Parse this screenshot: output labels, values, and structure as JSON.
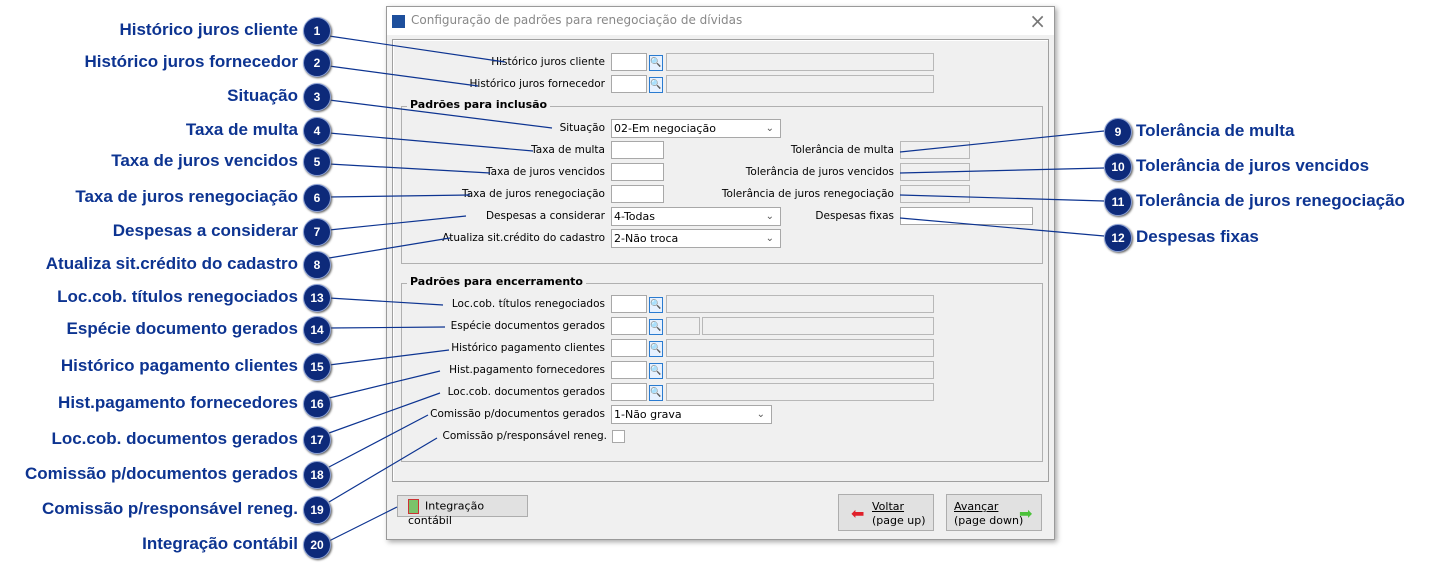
{
  "window": {
    "title": "Configuração de padrões para renegociação de dívidas",
    "close": "×"
  },
  "fields": {
    "historico_juros_cliente": "Histórico juros cliente",
    "historico_juros_fornecedor": "Histórico juros fornecedor",
    "group_inclusao": "Padrões para inclusão",
    "situacao": "Situação",
    "situacao_value": "02-Em negociação",
    "taxa_multa": "Taxa de multa",
    "taxa_juros_vencidos": "Taxa de juros vencidos",
    "taxa_juros_renegociacao": "Taxa de juros renegociação",
    "despesas_considerar": "Despesas a considerar",
    "despesas_considerar_value": "4-Todas",
    "atualiza_sit": "Atualiza sit.crédito do cadastro",
    "atualiza_sit_value": "2-Não troca",
    "tolerancia_multa": "Tolerância de multa",
    "tolerancia_juros_vencidos": "Tolerância de juros vencidos",
    "tolerancia_juros_renegociacao": "Tolerância de juros renegociação",
    "despesas_fixas": "Despesas fixas",
    "group_encerramento": "Padrões para encerramento",
    "loc_cob_titulos": "Loc.cob. títulos renegociados",
    "especie_documentos": "Espécie documentos gerados",
    "historico_pagamento_clientes": "Histórico pagamento clientes",
    "hist_pagamento_fornecedores": "Hist.pagamento fornecedores",
    "loc_cob_documentos": "Loc.cob. documentos gerados",
    "comissao_documentos": "Comissão p/documentos gerados",
    "comissao_documentos_value": "1-Não grava",
    "comissao_responsavel": "Comissão p/responsável reneg."
  },
  "buttons": {
    "integracao": "Integração contábil",
    "voltar": "Voltar",
    "voltar_sub": "(page up)",
    "avancar": "Avançar",
    "avancar_sub": "(page down)"
  },
  "callouts": [
    {
      "n": "1",
      "label": "Histórico juros cliente"
    },
    {
      "n": "2",
      "label": "Histórico juros fornecedor"
    },
    {
      "n": "3",
      "label": "Situação"
    },
    {
      "n": "4",
      "label": "Taxa de multa"
    },
    {
      "n": "5",
      "label": "Taxa de juros vencidos"
    },
    {
      "n": "6",
      "label": "Taxa de juros renegociação"
    },
    {
      "n": "7",
      "label": "Despesas a considerar"
    },
    {
      "n": "8",
      "label": "Atualiza sit.crédito do cadastro"
    },
    {
      "n": "9",
      "label": "Tolerância de multa"
    },
    {
      "n": "10",
      "label": "Tolerância de juros vencidos"
    },
    {
      "n": "11",
      "label": "Tolerância de juros renegociação"
    },
    {
      "n": "12",
      "label": "Despesas fixas"
    },
    {
      "n": "13",
      "label": "Loc.cob. títulos renegociados"
    },
    {
      "n": "14",
      "label": "Espécie documento gerados"
    },
    {
      "n": "15",
      "label": "Histórico pagamento clientes"
    },
    {
      "n": "16",
      "label": "Hist.pagamento fornecedores"
    },
    {
      "n": "17",
      "label": "Loc.cob. documentos gerados"
    },
    {
      "n": "18",
      "label": "Comissão p/documentos gerados"
    },
    {
      "n": "19",
      "label": "Comissão p/responsável reneg."
    },
    {
      "n": "20",
      "label": "Integração contábil"
    }
  ],
  "colors": {
    "callout": "#0d3491",
    "badge": "#0d2a7a"
  }
}
